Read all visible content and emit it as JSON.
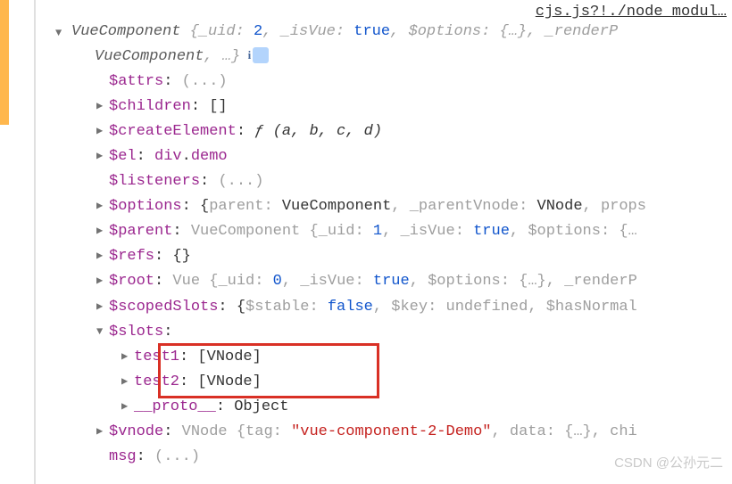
{
  "link_top": "cjs.js?!./node_modul…",
  "top_line": {
    "component": "VueComponent",
    "brace_open": "{",
    "uid_key": "_uid",
    "uid_val": "2",
    "isVue_key": "_isVue",
    "isVue_val": "true",
    "options_key": "$options",
    "options_val": "{…}",
    "renderP": "_renderP",
    "line2_component": "VueComponent",
    "line2_tail": ", …}"
  },
  "attrs": {
    "key": "$attrs",
    "val": "(...)"
  },
  "children": {
    "key": "$children",
    "val": "[]"
  },
  "createElement": {
    "key": "$createElement",
    "fn": "ƒ",
    "args": "(a, b, c, d)"
  },
  "el": {
    "key": "$el",
    "tag": "div",
    "cls": "demo"
  },
  "listeners": {
    "key": "$listeners",
    "val": "(...)"
  },
  "options": {
    "key": "$options",
    "parent_key": "parent",
    "parent_val": "VueComponent",
    "pvnode_key": "_parentVnode",
    "pvnode_val": "VNode",
    "props_key": "props"
  },
  "parent": {
    "key": "$parent",
    "cls": "VueComponent",
    "uid_key": "_uid",
    "uid_val": "1",
    "isVue_key": "_isVue",
    "isVue_val": "true",
    "options_key": "$options",
    "options_val": "{…"
  },
  "refs": {
    "key": "$refs",
    "val": "{}"
  },
  "root": {
    "key": "$root",
    "cls": "Vue",
    "uid_key": "_uid",
    "uid_val": "0",
    "isVue_key": "_isVue",
    "isVue_val": "true",
    "options_key": "$options",
    "options_val": "{…}",
    "renderP": "_renderP"
  },
  "scopedSlots": {
    "key": "$scopedSlots",
    "stable_key": "$stable",
    "stable_val": "false",
    "keykey": "$key",
    "keyval": "undefined",
    "hn": "$hasNormal"
  },
  "slots": {
    "key": "$slots"
  },
  "test1": {
    "key": "test1",
    "val": "[VNode]"
  },
  "test2": {
    "key": "test2",
    "val": "[VNode]"
  },
  "proto": {
    "key": "__proto__",
    "val": "Object"
  },
  "vnode": {
    "key": "$vnode",
    "cls": "VNode",
    "tag_key": "tag",
    "tag_val": "\"vue-component-2-Demo\"",
    "data_key": "data",
    "data_val": "{…}",
    "chi": "chi"
  },
  "msg": {
    "key": "msg",
    "val": "(...)"
  },
  "watermark": "CSDN @公孙元二"
}
